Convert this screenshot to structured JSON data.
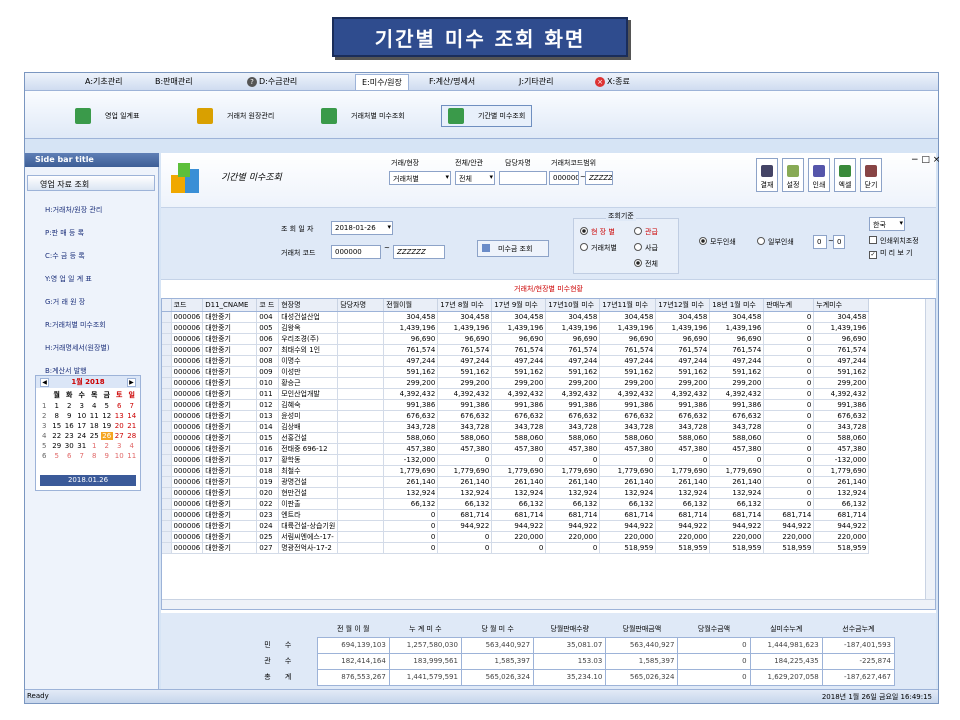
{
  "banner": {
    "title": "기간별 미수 조회 화면"
  },
  "menu": [
    {
      "label": "A:기초관리",
      "active": false
    },
    {
      "label": "B:판매관리",
      "active": false
    },
    {
      "label": "D:수금관리",
      "active": false,
      "icon": "?"
    },
    {
      "label": "E:미수/원장",
      "active": true
    },
    {
      "label": "F:계산/명세서",
      "active": false
    },
    {
      "label": "J:기타관리",
      "active": false
    },
    {
      "label": "X:종료",
      "active": false,
      "icon": "x"
    }
  ],
  "toolbar": [
    "영업 일계표",
    "거래처 원장관리",
    "거래처별 미수조회",
    "기간별 미수조회"
  ],
  "sidebar": {
    "title": "Side bar title",
    "group": "영업 자료 조회",
    "items": [
      "H:거래처/원장 관리",
      "P:판 매 등 록",
      "C:수 금 등 록",
      "Y:영 업 일 계 표",
      "G:거 래 원 장",
      "R:거래처별 미수조회",
      "H:거래명세서(원장별)",
      "B:계산서 발행"
    ]
  },
  "calendar": {
    "title": "1월 2018",
    "weekdays": [
      "월",
      "화",
      "수",
      "목",
      "금",
      "토",
      "일"
    ],
    "weeks": [
      {
        "wk": "1",
        "days": [
          "1",
          "2",
          "3",
          "4",
          "5",
          "6",
          "7"
        ]
      },
      {
        "wk": "2",
        "days": [
          "8",
          "9",
          "10",
          "11",
          "12",
          "13",
          "14"
        ]
      },
      {
        "wk": "3",
        "days": [
          "15",
          "16",
          "17",
          "18",
          "19",
          "20",
          "21"
        ]
      },
      {
        "wk": "4",
        "days": [
          "22",
          "23",
          "24",
          "25",
          "26",
          "27",
          "28"
        ]
      },
      {
        "wk": "5",
        "days": [
          "29",
          "30",
          "31",
          "1",
          "2",
          "3",
          "4"
        ]
      },
      {
        "wk": "6",
        "days": [
          "5",
          "6",
          "7",
          "8",
          "9",
          "10",
          "11"
        ]
      }
    ],
    "today": "2018.01.26"
  },
  "header": {
    "title": "기간별 미수조회",
    "filters": {
      "type_label": "거래/현장",
      "type_value": "거래처별",
      "scope_label": "전체/안관",
      "scope_value": "전체",
      "manager_label": "담당자명",
      "manager_value": "",
      "range_label": "거래처코드범위",
      "range_from": "000000",
      "range_to": "ZZZZZZ"
    },
    "buttons": [
      "결재",
      "설정",
      "인쇄",
      "엑셀",
      "닫기"
    ],
    "window_controls": [
      "−",
      "□",
      "×"
    ]
  },
  "form": {
    "date_label": "조 회 일 자",
    "date_value": "2018-01-26",
    "code_label": "거래처 코드",
    "code_from": "000000",
    "code_to": "ZZZZZZ",
    "query_button": "미수금 조회",
    "criteria_title": "조회기준",
    "criteria": [
      {
        "label": "현 장 별",
        "on": true,
        "red": true
      },
      {
        "label": "관급",
        "on": false,
        "red": true
      },
      {
        "label": "거래처별",
        "on": false,
        "red": false
      },
      {
        "label": "사급",
        "on": false,
        "red": false
      },
      {
        "label": "전체",
        "on": true,
        "red": false
      }
    ],
    "print_all": "모두인쇄",
    "print_part": "일부인쇄",
    "page_from": "0",
    "page_to": "0",
    "language": "한국",
    "opt_print_pos": "인쇄위치조정",
    "opt_preview": "미 리 보 기"
  },
  "section_title": "거래처/현장별 미수현황",
  "grid": {
    "columns": [
      "코드",
      "D11_CNAME",
      "코 드",
      "현장명",
      "담당자명",
      "전월이월",
      "17년 8월 미수",
      "17년 9월 미수",
      "17년10월 미수",
      "17년11월 미수",
      "17년12월 미수",
      "18년 1월 미수",
      "판매누계",
      "누계미수"
    ],
    "rows": [
      [
        "000006",
        "대한중기",
        "004",
        "대성건설산업",
        "",
        "304,458",
        "304,458",
        "304,458",
        "304,458",
        "304,458",
        "304,458",
        "304,458",
        "0",
        "304,458"
      ],
      [
        "000006",
        "대한중기",
        "005",
        "김왕옥",
        "",
        "1,439,196",
        "1,439,196",
        "1,439,196",
        "1,439,196",
        "1,439,196",
        "1,439,196",
        "1,439,196",
        "0",
        "1,439,196"
      ],
      [
        "000006",
        "대한중기",
        "006",
        "우리조경(주)",
        "",
        "96,690",
        "96,690",
        "96,690",
        "96,690",
        "96,690",
        "96,690",
        "96,690",
        "0",
        "96,690"
      ],
      [
        "000006",
        "대한중기",
        "007",
        "최태수외 1인",
        "",
        "761,574",
        "761,574",
        "761,574",
        "761,574",
        "761,574",
        "761,574",
        "761,574",
        "0",
        "761,574"
      ],
      [
        "000006",
        "대한중기",
        "008",
        "이명수",
        "",
        "497,244",
        "497,244",
        "497,244",
        "497,244",
        "497,244",
        "497,244",
        "497,244",
        "0",
        "497,244"
      ],
      [
        "000006",
        "대한중기",
        "009",
        "이성만",
        "",
        "591,162",
        "591,162",
        "591,162",
        "591,162",
        "591,162",
        "591,162",
        "591,162",
        "0",
        "591,162"
      ],
      [
        "000006",
        "대한중기",
        "010",
        "황승근",
        "",
        "299,200",
        "299,200",
        "299,200",
        "299,200",
        "299,200",
        "299,200",
        "299,200",
        "0",
        "299,200"
      ],
      [
        "000006",
        "대한중기",
        "011",
        "모인산업개발",
        "",
        "4,392,432",
        "4,392,432",
        "4,392,432",
        "4,392,432",
        "4,392,432",
        "4,392,432",
        "4,392,432",
        "0",
        "4,392,432"
      ],
      [
        "000006",
        "대한중기",
        "012",
        "김혜숙",
        "",
        "991,386",
        "991,386",
        "991,386",
        "991,386",
        "991,386",
        "991,386",
        "991,386",
        "0",
        "991,386"
      ],
      [
        "000006",
        "대한중기",
        "013",
        "윤성미",
        "",
        "676,632",
        "676,632",
        "676,632",
        "676,632",
        "676,632",
        "676,632",
        "676,632",
        "0",
        "676,632"
      ],
      [
        "000006",
        "대한중기",
        "014",
        "김상배",
        "",
        "343,728",
        "343,728",
        "343,728",
        "343,728",
        "343,728",
        "343,728",
        "343,728",
        "0",
        "343,728"
      ],
      [
        "000006",
        "대한중기",
        "015",
        "선홍건설",
        "",
        "588,060",
        "588,060",
        "588,060",
        "588,060",
        "588,060",
        "588,060",
        "588,060",
        "0",
        "588,060"
      ],
      [
        "000006",
        "대한중기",
        "016",
        "전태중 696-12",
        "",
        "457,380",
        "457,380",
        "457,380",
        "457,380",
        "457,380",
        "457,380",
        "457,380",
        "0",
        "457,380"
      ],
      [
        "000006",
        "대한중기",
        "017",
        "황학동",
        "",
        "-132,000",
        "0",
        "0",
        "0",
        "0",
        "0",
        "0",
        "0",
        "-132,000"
      ],
      [
        "000006",
        "대한중기",
        "018",
        "최철수",
        "",
        "1,779,690",
        "1,779,690",
        "1,779,690",
        "1,779,690",
        "1,779,690",
        "1,779,690",
        "1,779,690",
        "0",
        "1,779,690"
      ],
      [
        "000006",
        "대한중기",
        "019",
        "광명건설",
        "",
        "261,140",
        "261,140",
        "261,140",
        "261,140",
        "261,140",
        "261,140",
        "261,140",
        "0",
        "261,140"
      ],
      [
        "000006",
        "대한중기",
        "020",
        "현만건설",
        "",
        "132,924",
        "132,924",
        "132,924",
        "132,924",
        "132,924",
        "132,924",
        "132,924",
        "0",
        "132,924"
      ],
      [
        "000006",
        "대한중기",
        "022",
        "이판출",
        "",
        "66,132",
        "66,132",
        "66,132",
        "66,132",
        "66,132",
        "66,132",
        "66,132",
        "0",
        "66,132"
      ],
      [
        "000006",
        "대한중기",
        "023",
        "엔트라",
        "",
        "0",
        "681,714",
        "681,714",
        "681,714",
        "681,714",
        "681,714",
        "681,714",
        "681,714",
        "681,714"
      ],
      [
        "000006",
        "대한중기",
        "024",
        "대륙건설-상습기원",
        "",
        "0",
        "944,922",
        "944,922",
        "944,922",
        "944,922",
        "944,922",
        "944,922",
        "944,922",
        "944,922"
      ],
      [
        "000006",
        "대한중기",
        "025",
        "서림씨엔에스-17-",
        "",
        "0",
        "0",
        "220,000",
        "220,000",
        "220,000",
        "220,000",
        "220,000",
        "220,000",
        "220,000"
      ],
      [
        "000006",
        "대한중기",
        "027",
        "명광전억사-17-2",
        "",
        "0",
        "0",
        "0",
        "0",
        "518,959",
        "518,959",
        "518,959",
        "518,959",
        "518,959"
      ]
    ]
  },
  "summary": {
    "headers": [
      "전 월 이 월",
      "누 계 미 수",
      "당 월 미 수",
      "당월판매수량",
      "당월판매금액",
      "당월수금액",
      "실미수누계",
      "선수금누계"
    ],
    "rows": [
      {
        "label": "민 수",
        "values": [
          "694,139,103",
          "1,257,580,030",
          "563,440,927",
          "35,081.07",
          "563,440,927",
          "0",
          "1,444,981,623",
          "-187,401,593"
        ]
      },
      {
        "label": "관 수",
        "values": [
          "182,414,164",
          "183,999,561",
          "1,585,397",
          "153.03",
          "1,585,397",
          "0",
          "184,225,435",
          "-225,874"
        ]
      },
      {
        "label": "총 계",
        "values": [
          "876,553,267",
          "1,441,579,591",
          "565,026,324",
          "35,234.10",
          "565,026,324",
          "0",
          "1,629,207,058",
          "-187,627,467"
        ]
      }
    ]
  },
  "status": {
    "left": "Ready",
    "right": "2018년 1월 26일 금요일 16:49:15"
  }
}
